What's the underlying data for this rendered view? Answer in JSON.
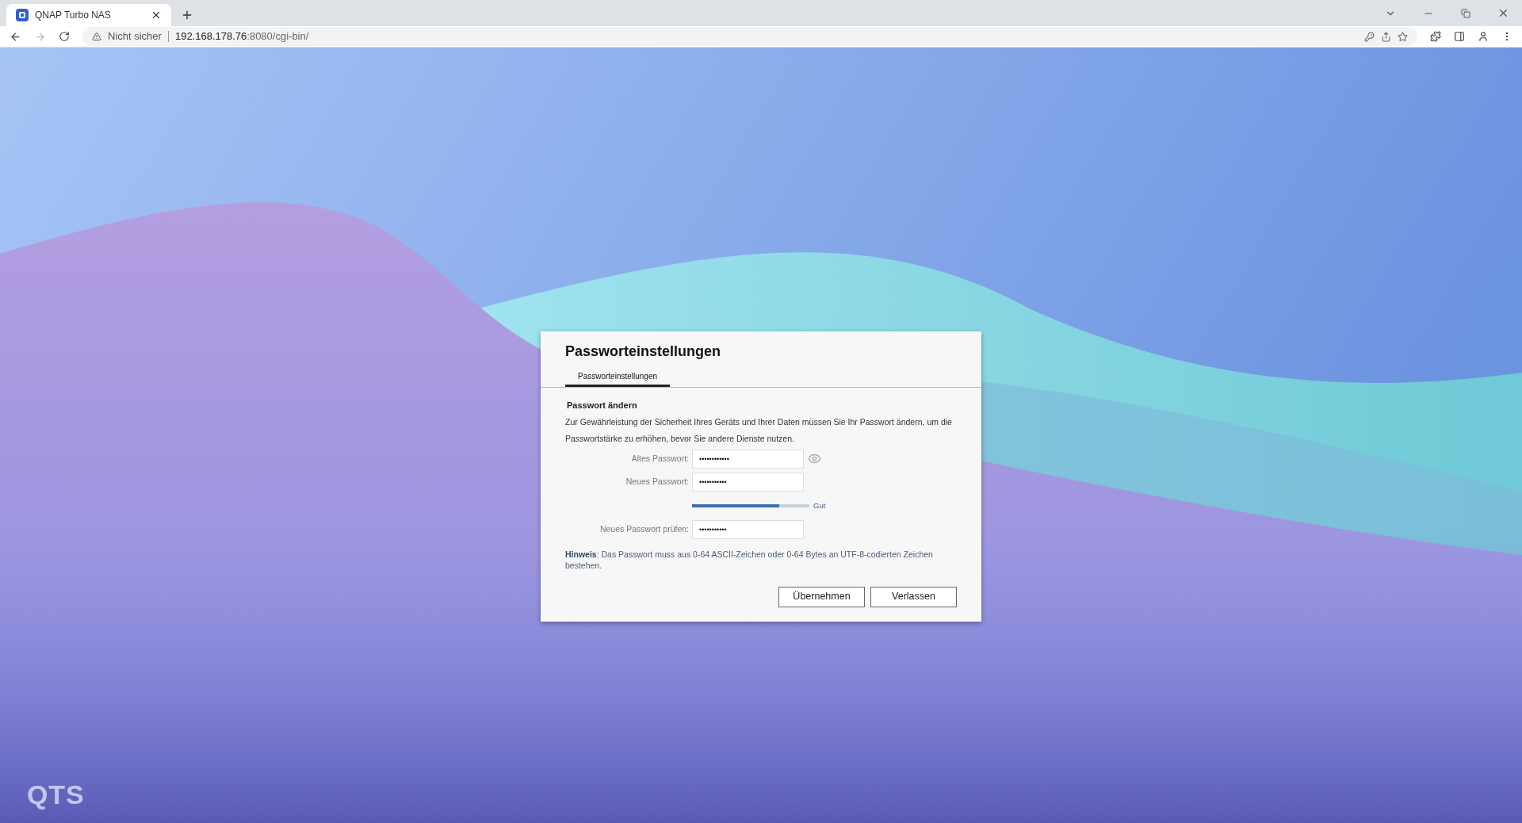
{
  "browser": {
    "tab": {
      "title": "QNAP Turbo NAS",
      "selected": true
    },
    "address": {
      "security": "Nicht sicher",
      "host": "192.168.178.76",
      "path": ":8080/cgi-bin/"
    }
  },
  "dialog": {
    "title": "Passworteinstellungen",
    "tabs": [
      {
        "label": "Passworteinstellungen",
        "selected": true
      }
    ],
    "section": "Passwort ändern",
    "description": "Zur Gewährleistung der Sicherheit Ihres Geräts und Ihrer Daten müssen Sie Ihr Passwort ändern, um die Passwortstärke zu erhöhen, bevor Sie andere Dienste nutzen.",
    "fields": [
      {
        "kind": "password",
        "label": "Altes Passwort:",
        "value": "••••••••••••",
        "reveal": true
      },
      {
        "kind": "password",
        "label": "Neues Passwort:",
        "value": "•••••••••••",
        "reveal": false
      },
      {
        "kind": "strength",
        "level": 0.74,
        "reading": "Gut"
      },
      {
        "kind": "password",
        "label": "Neues Passwort prüfen:",
        "value": "•••••••••••",
        "reveal": false
      }
    ],
    "hint": "**Hinweis**: Das Passwort muss aus 0-64 ASCII-Zeichen oder 0-64 Bytes an UTF-8-codierten Zeichen bestehen.",
    "buttons": [
      "Übernehmen",
      "Verlassen"
    ]
  },
  "brand": "QTS"
}
